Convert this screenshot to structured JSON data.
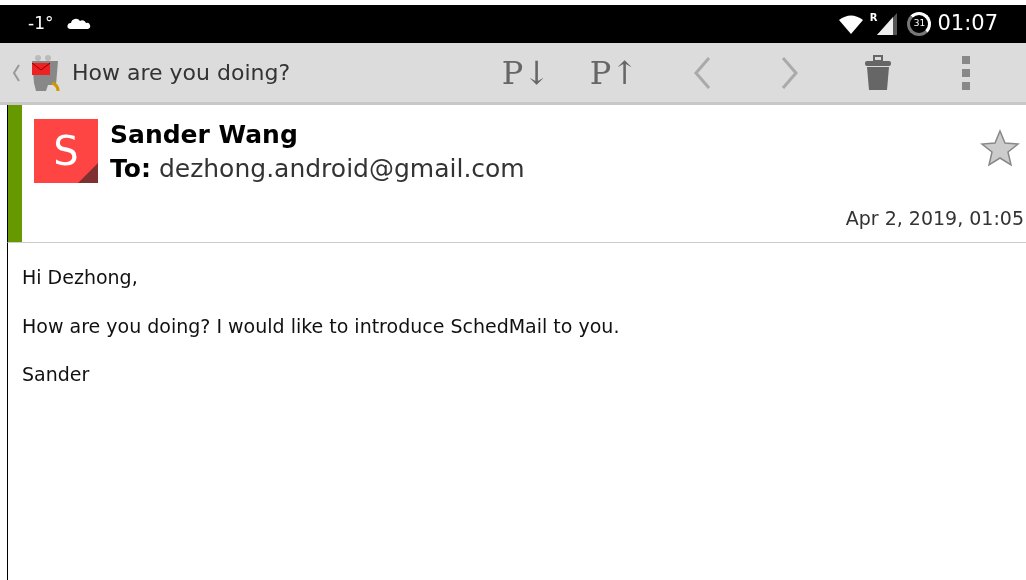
{
  "status_bar": {
    "temperature": "-1°",
    "signal_label": "R",
    "battery": "31",
    "time": "01:07"
  },
  "toolbar": {
    "title": "How are you doing?",
    "actions": [
      {
        "kind": "text",
        "label": "P↓"
      },
      {
        "kind": "text",
        "label": "P↑"
      },
      {
        "kind": "prev"
      },
      {
        "kind": "next"
      },
      {
        "kind": "delete"
      },
      {
        "kind": "menu"
      }
    ]
  },
  "message": {
    "avatar_letter": "S",
    "sender": "Sander Wang",
    "to_label": "To:",
    "to": "dezhong.android@gmail.com",
    "starred": false,
    "date": "Apr 2, 2019, 01:05",
    "body": [
      "Hi Dezhong,",
      "How are you doing? I would like to introduce SchedMail to you.",
      "Sander"
    ]
  }
}
